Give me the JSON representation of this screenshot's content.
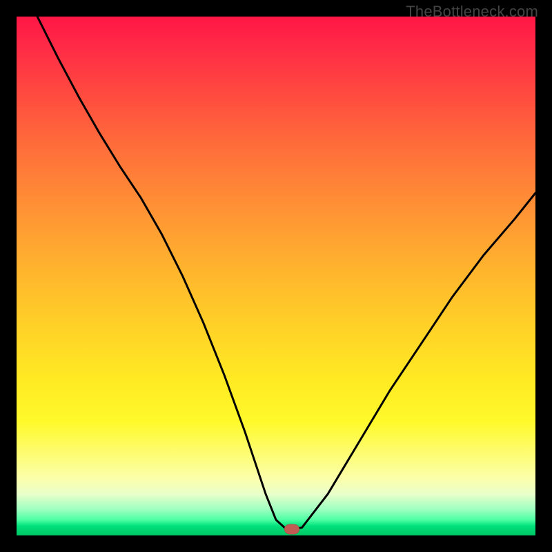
{
  "watermark": "TheBottleneck.com",
  "colors": {
    "curve": "#000000",
    "marker": "#c15b53",
    "frame": "#000000"
  },
  "chart_data": {
    "type": "line",
    "title": "",
    "xlabel": "",
    "ylabel": "",
    "xlim": [
      0,
      100
    ],
    "ylim": [
      0,
      100
    ],
    "grid": false,
    "series": [
      {
        "name": "bottleneck-curve",
        "x": [
          4,
          8,
          12,
          16,
          20,
          24,
          28,
          32,
          36,
          40,
          44,
          48,
          50,
          52,
          53,
          55,
          60,
          66,
          72,
          78,
          84,
          90,
          96,
          100
        ],
        "y": [
          100,
          92,
          84.5,
          77.5,
          71,
          65,
          58,
          50,
          41,
          31,
          20,
          8,
          3,
          1.2,
          1.2,
          1.5,
          8,
          18,
          28,
          37,
          46,
          54,
          61,
          66
        ]
      }
    ],
    "marker": {
      "x": 53,
      "y": 1.2
    },
    "background_gradient_stops": [
      {
        "pct": 0,
        "color": "#ff1645"
      },
      {
        "pct": 24,
        "color": "#ff6a3b"
      },
      {
        "pct": 48,
        "color": "#ffb22e"
      },
      {
        "pct": 70,
        "color": "#ffea23"
      },
      {
        "pct": 89,
        "color": "#fcffaa"
      },
      {
        "pct": 95,
        "color": "#9dffc1"
      },
      {
        "pct": 100,
        "color": "#00c765"
      }
    ]
  }
}
